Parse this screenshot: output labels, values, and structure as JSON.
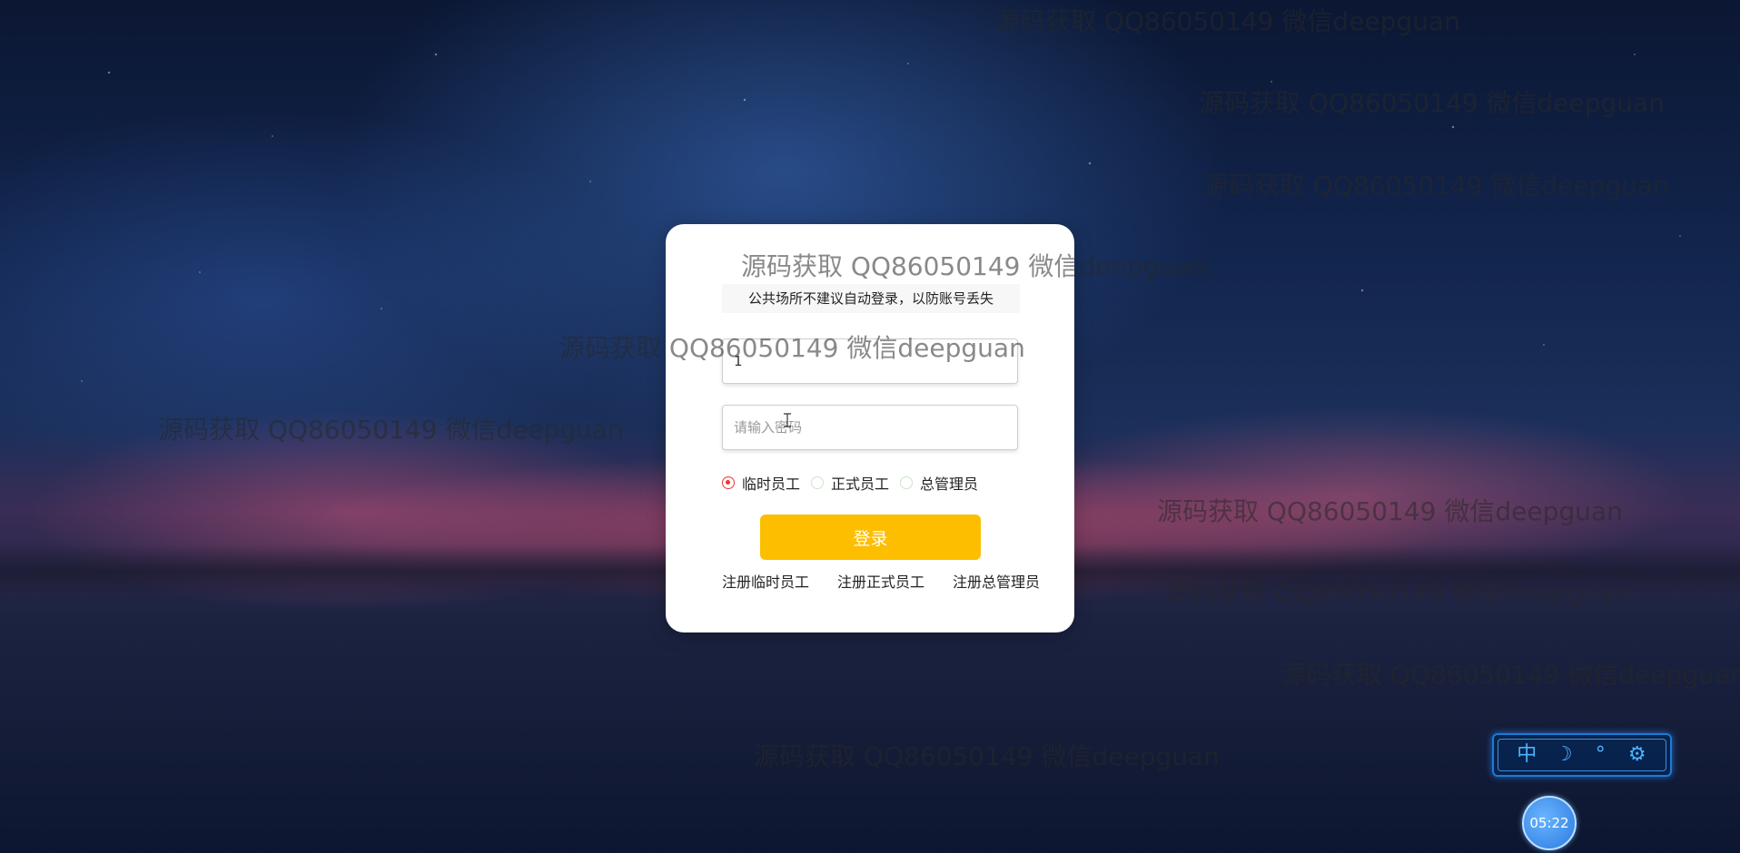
{
  "watermark_text": "源码获取 QQ86050149 微信deepguan",
  "login": {
    "notice": "公共场所不建议自动登录，以防账号丢失",
    "username_value": "1",
    "password_placeholder": "请输入密码",
    "roles": [
      {
        "label": "临时员工",
        "checked": true
      },
      {
        "label": "正式员工",
        "checked": false
      },
      {
        "label": "总管理员",
        "checked": false
      }
    ],
    "submit_label": "登录",
    "register_links": [
      "注册临时员工",
      "注册正式员工",
      "注册总管理员"
    ]
  },
  "toolbar": {
    "items": [
      {
        "name": "chinese-language-icon",
        "glyph": "中"
      },
      {
        "name": "moon-icon",
        "glyph": "☽"
      },
      {
        "name": "temperature-icon",
        "glyph": "°"
      },
      {
        "name": "gear-icon",
        "glyph": "⚙"
      }
    ]
  },
  "clock": {
    "time": "05:22"
  },
  "colors": {
    "submit_button": "#fdbe00",
    "radio_checked": "#e53935",
    "toolbar_accent": "#4db2ff"
  }
}
